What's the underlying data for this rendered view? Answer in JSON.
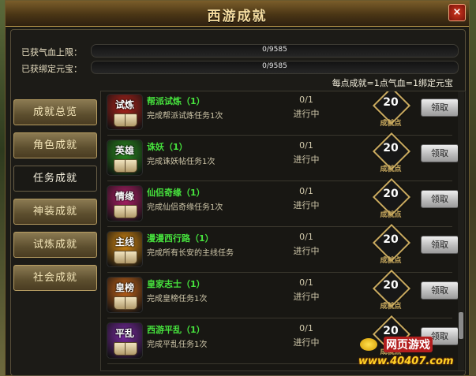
{
  "window": {
    "title": "西游成就",
    "close_label": "×"
  },
  "stats": [
    {
      "label": "已获气血上限：",
      "value_text": "0/9585",
      "fraction": 0
    },
    {
      "label": "已获绑定元宝：",
      "value_text": "0/9585",
      "fraction": 0
    }
  ],
  "exchange_note": "每点成就=1点气血=1绑定元宝",
  "nav": [
    {
      "label": "成就总览",
      "active": false
    },
    {
      "label": "角色成就",
      "active": false
    },
    {
      "label": "任务成就",
      "active": true
    },
    {
      "label": "神装成就",
      "active": false
    },
    {
      "label": "试炼成就",
      "active": false
    },
    {
      "label": "社会成就",
      "active": false
    }
  ],
  "achievements": [
    {
      "badge": "试炼",
      "badge_color": "#b3231b",
      "name": "帮派试炼（1）",
      "desc": "完成帮派试炼任务1次",
      "progress": "0/1",
      "status": "进行中",
      "points": "20",
      "points_label": "成就点",
      "button": "领取"
    },
    {
      "badge": "英雄",
      "badge_color": "#2a8f1f",
      "name": "诛妖（1）",
      "desc": "完成诛妖帖任务1次",
      "progress": "0/1",
      "status": "进行中",
      "points": "20",
      "points_label": "成就点",
      "button": "领取"
    },
    {
      "badge": "情缘",
      "badge_color": "#b51f6b",
      "name": "仙侣奇缘（1）",
      "desc": "完成仙侣奇缘任务1次",
      "progress": "0/1",
      "status": "进行中",
      "points": "20",
      "points_label": "成就点",
      "button": "领取"
    },
    {
      "badge": "主线",
      "badge_color": "#d88a12",
      "name": "漫漫西行路（1）",
      "desc": "完成所有长安的主线任务",
      "progress": "0/1",
      "status": "进行中",
      "points": "20",
      "points_label": "成就点",
      "button": "领取"
    },
    {
      "badge": "皇榜",
      "badge_color": "#c8661a",
      "name": "皇家志士（1）",
      "desc": "完成皇榜任务1次",
      "progress": "0/1",
      "status": "进行中",
      "points": "20",
      "points_label": "成就点",
      "button": "领取"
    },
    {
      "badge": "平乱",
      "badge_color": "#7a2aa3",
      "name": "西游平乱（1）",
      "desc": "完成平乱任务1次",
      "progress": "0/1",
      "status": "进行中",
      "points": "20",
      "points_label": "成就点",
      "button": "领取"
    }
  ],
  "watermark": {
    "brand": "网页游戏",
    "url": "www.40407.com"
  }
}
